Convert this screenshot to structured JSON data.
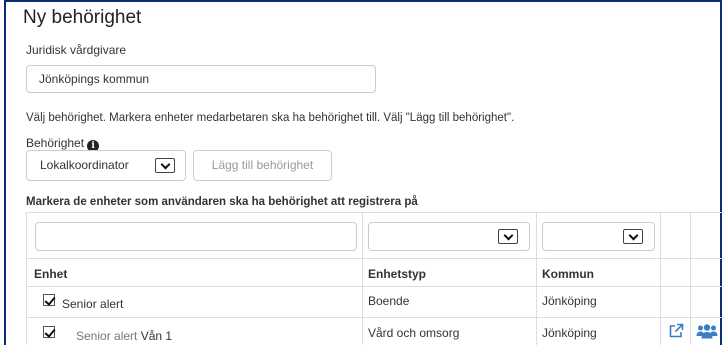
{
  "page": {
    "title": "Ny behörighet",
    "juridisk_label": "Juridisk vårdgivare",
    "juridisk_value": "Jönköpings kommun",
    "instruction": "Välj behörighet. Markera enheter medarbetaren ska ha behörighet till. Välj \"Lägg till behörighet\".",
    "behorighet_label": "Behörighet",
    "behorighet_selected": "Lokalkoordinator",
    "add_button": "Lägg till behörighet",
    "section_heading": "Markera de enheter som användaren ska ha behörighet att registrera på"
  },
  "table": {
    "columns": [
      "Enhet",
      "Enhetstyp",
      "Kommun"
    ],
    "filters": {
      "enhet": "",
      "enhetstyp": "",
      "kommun": ""
    },
    "rows": [
      {
        "checked": true,
        "enhet": "Senior alert",
        "enhet_suffix": "",
        "enhetstyp": "Boende",
        "kommun": "Jönköping"
      },
      {
        "checked": true,
        "enhet": "Senior alert",
        "enhet_suffix": "Vån 1",
        "enhetstyp": "Vård och omsorg",
        "kommun": "Jönköping"
      }
    ]
  },
  "icons": {
    "info": "info-circle-icon",
    "chevron": "chevron-down-icon",
    "external_link": "external-link-icon",
    "users": "users-icon"
  },
  "colors": {
    "frame_border": "#0d2b78",
    "accent_blue": "#3a7fc4"
  }
}
